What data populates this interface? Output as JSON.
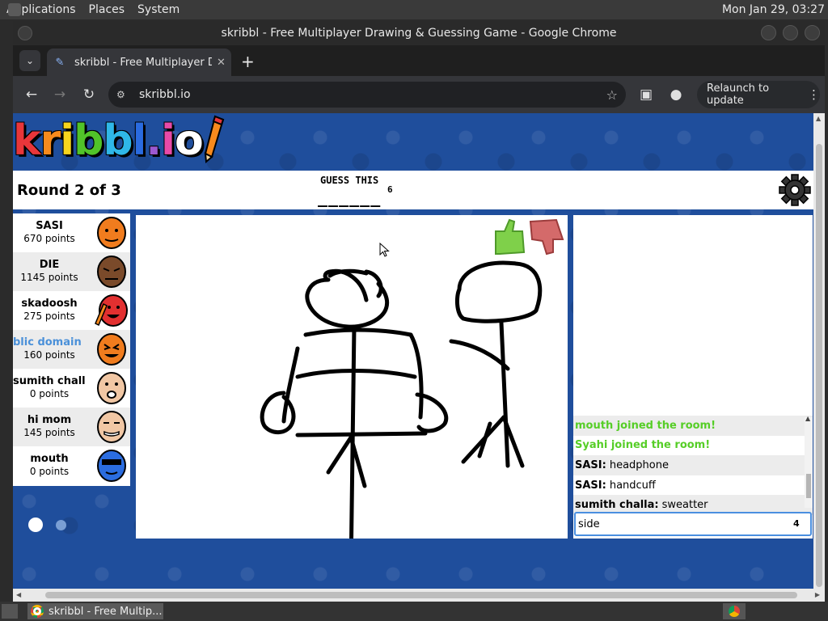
{
  "os": {
    "menus": [
      "Applications",
      "Places",
      "System"
    ],
    "clock": "Mon Jan 29, 03:27"
  },
  "browser": {
    "window_title": "skribbl - Free Multiplayer Drawing & Guessing Game - Google Chrome",
    "tab_title": "skribbl - Free Multiplayer Drawing & Guessing Game",
    "url": "skribbl.io",
    "relaunch_label": "Relaunch to update"
  },
  "game": {
    "logo_text": "skribbl.io",
    "round": "Round 2 of 3",
    "guess_label": "GUESS THIS",
    "guess_blanks": "______",
    "guess_length": "6",
    "players": [
      {
        "name": "SASI",
        "points": "670 points",
        "avatar_color": "#f07c1e"
      },
      {
        "name": "DIE",
        "points": "1145 points",
        "avatar_color": "#7a4a2a"
      },
      {
        "name": "skadoosh",
        "points": "275 points",
        "avatar_color": "#e23030"
      },
      {
        "name": "blic domain (You",
        "points": "160 points",
        "avatar_color": "#f07c1e"
      },
      {
        "name": "sumith challa",
        "points": "0 points",
        "avatar_color": "#f1c7a4"
      },
      {
        "name": "hi mom",
        "points": "145 points",
        "avatar_color": "#f1c7a4"
      },
      {
        "name": "mouth",
        "points": "0 points",
        "avatar_color": "#2b6de0"
      }
    ],
    "chat": [
      {
        "type": "join",
        "text": "mouth joined the room!"
      },
      {
        "type": "join",
        "text": "Syahi joined the room!"
      },
      {
        "type": "msg",
        "who": "SASI:",
        "text": "headphone"
      },
      {
        "type": "msg",
        "who": "SASI:",
        "text": "handcuff"
      },
      {
        "type": "msg",
        "who": "sumith challa:",
        "text": "sweatter"
      }
    ],
    "chat_input_value": "side",
    "chat_input_count": "4"
  },
  "taskbar": {
    "chrome_task": "skribbl - Free Multip..."
  },
  "colors": {
    "page_blue": "#1f4e9c",
    "join_green": "#56ce27",
    "self_blue": "#4a90d9"
  }
}
